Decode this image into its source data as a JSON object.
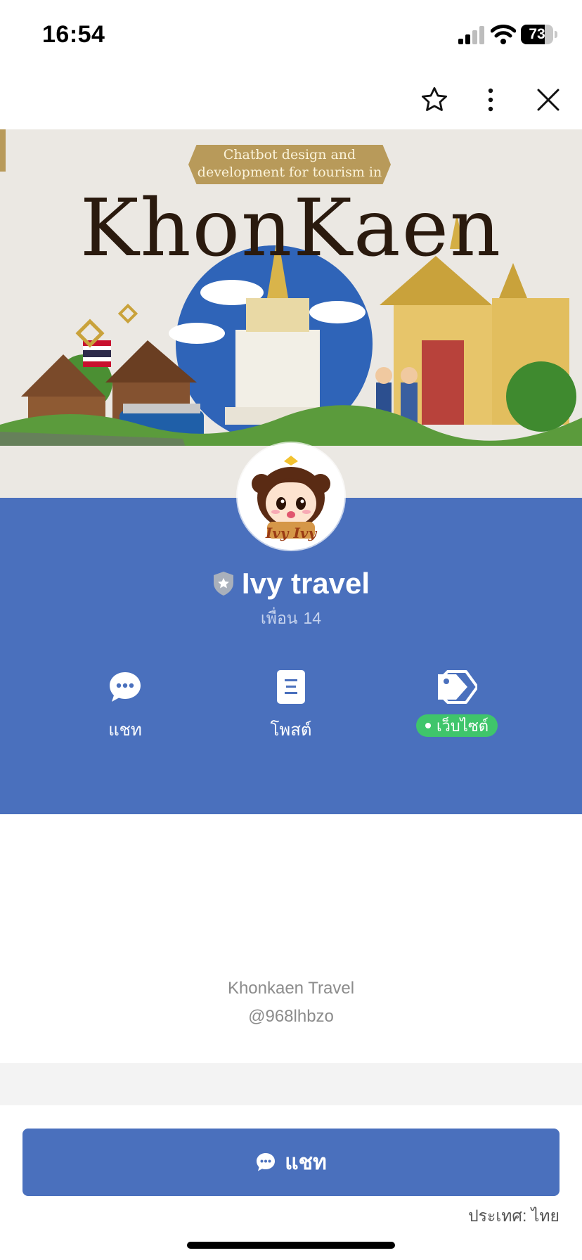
{
  "status_bar": {
    "time": "16:54",
    "battery_level": "73",
    "battery_fraction": 0.73
  },
  "top_bar": {
    "icons": [
      "star-icon",
      "more-vertical-icon",
      "close-icon"
    ]
  },
  "cover": {
    "tagline_line1": "Chatbot design and",
    "tagline_line2": "development for tourism in",
    "title": "KhonKaen"
  },
  "profile": {
    "avatar_text": "Ivy Ivy",
    "name": "Ivy travel",
    "friends_label": "เพื่อน",
    "friends_count": "14"
  },
  "actions": [
    {
      "label": "แชท",
      "icon": "chat-bubble-icon"
    },
    {
      "label": "โพสต์",
      "icon": "post-document-icon"
    },
    {
      "label": "เว็บไซต์",
      "icon": "tag-icon"
    }
  ],
  "account": {
    "display_name": "Khonkaen Travel",
    "line_id": "@968lhbzo"
  },
  "bottom": {
    "chat_button_label": "แชท",
    "country_text": "ประเทศ: ไทย"
  },
  "colors": {
    "brand_blue": "#4a70bd",
    "website_green": "#3fc56b"
  }
}
